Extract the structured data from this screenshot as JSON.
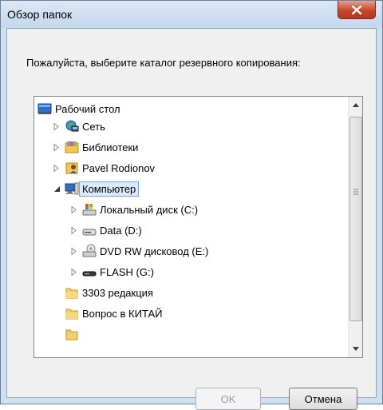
{
  "dialog": {
    "title": "Обзор папок",
    "prompt": "Пожалуйста, выберите каталог резервного копирования:"
  },
  "tree": {
    "items": [
      {
        "label": "Рабочий стол",
        "icon": "desktop-icon",
        "expander": "none"
      },
      {
        "label": "Сеть",
        "icon": "network-icon",
        "expander": "collapsed"
      },
      {
        "label": "Библиотеки",
        "icon": "libraries-icon",
        "expander": "collapsed"
      },
      {
        "label": "Pavel Rodionov",
        "icon": "user-folder-icon",
        "expander": "collapsed"
      },
      {
        "label": "Компьютер",
        "icon": "computer-icon",
        "expander": "expanded",
        "selected": true
      },
      {
        "label": "Локальный диск (C:)",
        "icon": "system-drive-icon",
        "expander": "collapsed"
      },
      {
        "label": "Data (D:)",
        "icon": "hard-drive-icon",
        "expander": "collapsed"
      },
      {
        "label": "DVD RW дисковод (E:)",
        "icon": "dvd-drive-icon",
        "expander": "collapsed"
      },
      {
        "label": "FLASH (G:)",
        "icon": "flash-drive-icon",
        "expander": "collapsed"
      },
      {
        "label": "3303 редакция",
        "icon": "folder-icon",
        "expander": "none"
      },
      {
        "label": "Вопрос в КИТАЙ",
        "icon": "folder-icon",
        "expander": "none"
      }
    ]
  },
  "buttons": {
    "ok": "OK",
    "cancel": "Отмена"
  },
  "colors": {
    "selection_bg": "#dcebfc",
    "selection_border": "#7da2ce",
    "close_button": "#c7462c"
  }
}
